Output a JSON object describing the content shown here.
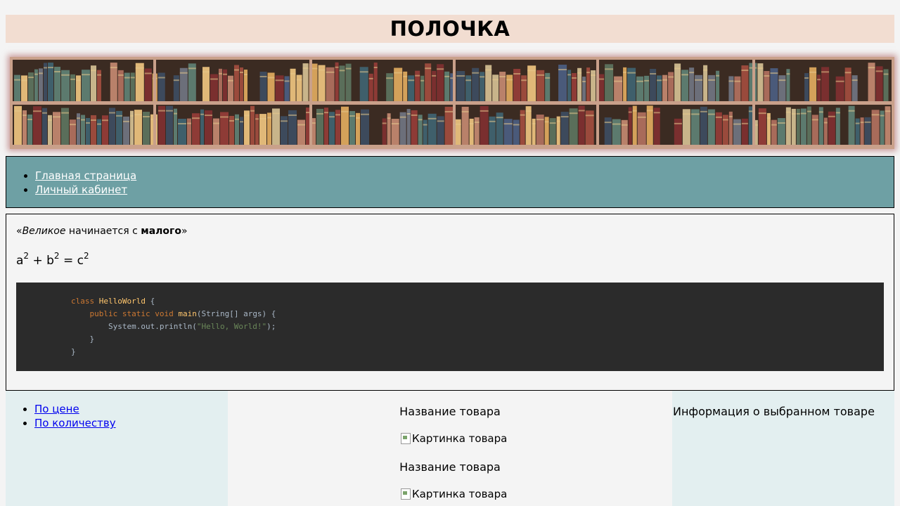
{
  "header": {
    "title": "ПОЛОЧКА"
  },
  "banner": {
    "image_alt": "bookshelf-banner"
  },
  "nav": {
    "items": [
      {
        "label": "Главная страница"
      },
      {
        "label": "Личный кабинет"
      }
    ]
  },
  "content": {
    "quote": {
      "open": "«",
      "emphasis": "Великое",
      "middle": " начинается с ",
      "strong": "малого",
      "close": "»"
    },
    "formula": {
      "a": "a",
      "b": "b",
      "c": "c",
      "exp": "2",
      "plus": " + ",
      "eq": " = "
    },
    "code": {
      "line1_kw": "class",
      "line1_name": "HelloWorld",
      "line1_rest": " {",
      "line2_kw": "public static void",
      "line2_fn": "main",
      "line2_rest": "(String[] args) {",
      "line3_pre": "System.out.println(",
      "line3_str": "\"Hello, World!\"",
      "line3_post": ");",
      "line4": "}",
      "line5": "}"
    }
  },
  "sidebar_left": {
    "items": [
      {
        "label": "По цене"
      },
      {
        "label": "По количеству"
      }
    ]
  },
  "products": {
    "items": [
      {
        "title": "Название товара",
        "image_alt": "Картинка товара"
      },
      {
        "title": "Название товара",
        "image_alt": "Картинка товара"
      }
    ]
  },
  "sidebar_right": {
    "info": "Информация о выбранном товаре"
  },
  "colors": {
    "header_bg": "#f2ddd1",
    "nav_bg": "#6ea0a4",
    "sidebar_bg": "#e3eff0",
    "code_bg": "#2b2b2b",
    "link": "#0000ee"
  }
}
